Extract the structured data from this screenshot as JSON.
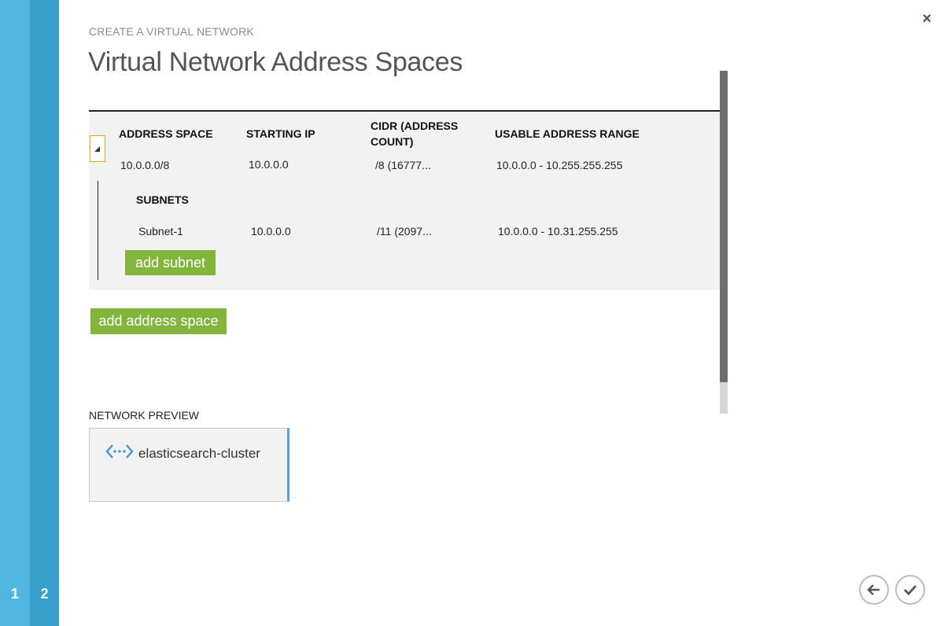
{
  "steps": [
    {
      "number": "1"
    },
    {
      "number": "2"
    }
  ],
  "close_icon": "×",
  "wizard": {
    "caption": "CREATE A VIRTUAL NETWORK",
    "title": "Virtual Network Address Spaces"
  },
  "table": {
    "headers": {
      "address_space": "ADDRESS SPACE",
      "starting_ip": "STARTING IP",
      "cidr": "CIDR (ADDRESS COUNT)",
      "usable_range": "USABLE ADDRESS RANGE"
    },
    "address_space_row": {
      "address_space": "10.0.0.0/8",
      "starting_ip": "10.0.0.0",
      "cidr": "/8 (16777...",
      "usable_range": "10.0.0.0 - 10.255.255.255"
    },
    "subnets_label": "SUBNETS",
    "subnets": [
      {
        "name": "Subnet-1",
        "starting_ip": "10.0.0.0",
        "cidr": "/11 (2097...",
        "usable_range": "10.0.0.0 - 10.31.255.255"
      }
    ],
    "add_subnet_label": "add subnet"
  },
  "add_address_space_label": "add address space",
  "preview": {
    "label": "NETWORK PREVIEW",
    "network_name": "elasticsearch-cluster"
  },
  "colors": {
    "step1": "#51b6e1",
    "step2": "#369fcb",
    "button_green": "#83b43c",
    "toggle_border": "#f0a030",
    "preview_accent": "#5a9fd6"
  },
  "icons": {
    "close": "close-icon",
    "collapse": "collapse-triangle-icon",
    "network": "virtual-network-icon",
    "back": "back-arrow-icon",
    "confirm": "checkmark-icon"
  }
}
